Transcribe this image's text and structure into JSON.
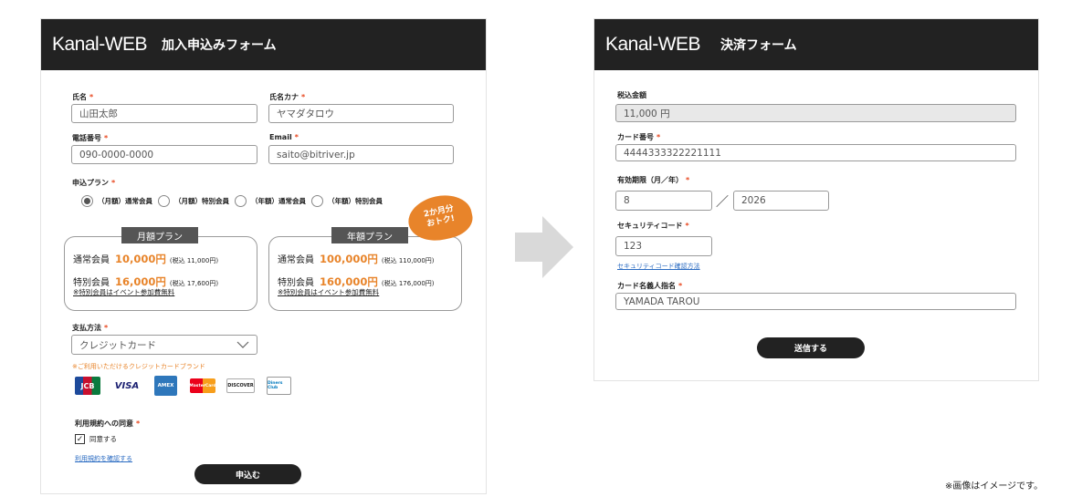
{
  "left_form": {
    "logo": "Kanal-WEB",
    "title": "加入申込みフォーム",
    "name_label": "氏名",
    "name_value": "山田太郎",
    "kana_label": "氏名カナ",
    "kana_value": "ヤマダタロウ",
    "phone_label": "電話番号",
    "phone_value": "090-0000-0000",
    "email_label": "Email",
    "email_value": "saito@bitriver.jp",
    "plan_label": "申込プラン",
    "plan_options": [
      "（月額）通常会員",
      "（月額）特別会員",
      "（年額）通常会員",
      "（年額）特別会員"
    ],
    "plan_selected_index": 0,
    "monthly": {
      "tab": "月額プラン",
      "regular_label": "通常会員",
      "regular_price": "10,000円",
      "regular_tax": "(税込 11,000円)",
      "special_label": "特別会員",
      "special_price": "16,000円",
      "special_tax": "(税込 17,600円)",
      "note": "※特別会員はイベント参加費無料"
    },
    "yearly": {
      "tab": "年額プラン",
      "regular_label": "通常会員",
      "regular_price": "100,000円",
      "regular_tax": "(税込 110,000円)",
      "special_label": "特別会員",
      "special_price": "160,000円",
      "special_tax": "(税込 176,000円)",
      "note": "※特別会員はイベント参加費無料"
    },
    "badge_line1": "2か月分",
    "badge_line2": "おトク!",
    "payment_label": "支払方法",
    "payment_value": "クレジットカード",
    "card_brands_note": "※ご利用いただけるクレジットカードブランド",
    "card_brands": [
      "JCB",
      "VISA",
      "AMEX",
      "MasterCard",
      "DISCOVER",
      "Diners Club"
    ],
    "terms_label": "利用規約への同意",
    "agree_label": "同意する",
    "terms_link": "利用規約を確認する",
    "submit_label": "申込む"
  },
  "right_form": {
    "logo": "Kanal-WEB",
    "title": "決済フォーム",
    "amount_label": "税込金額",
    "amount_value": "11,000 円",
    "card_number_label": "カード番号",
    "card_number_value": "4444333322221111",
    "expiry_label": "有効期限（月／年）",
    "expiry_month": "8",
    "expiry_sep": "／",
    "expiry_year": "2026",
    "cvc_label": "セキュリティコード",
    "cvc_value": "123",
    "cvc_link": "セキュリティコード確認方法",
    "holder_label": "カード名義人指名",
    "holder_value": "YAMADA TAROU",
    "submit_label": "送信する"
  },
  "required_mark": "*",
  "footnote": "※画像はイメージです。",
  "colors": {
    "header": "#222222",
    "accent": "#e8842a",
    "required": "#e8461e",
    "link": "#2a6bc2",
    "arrow": "#d9d9d9"
  }
}
